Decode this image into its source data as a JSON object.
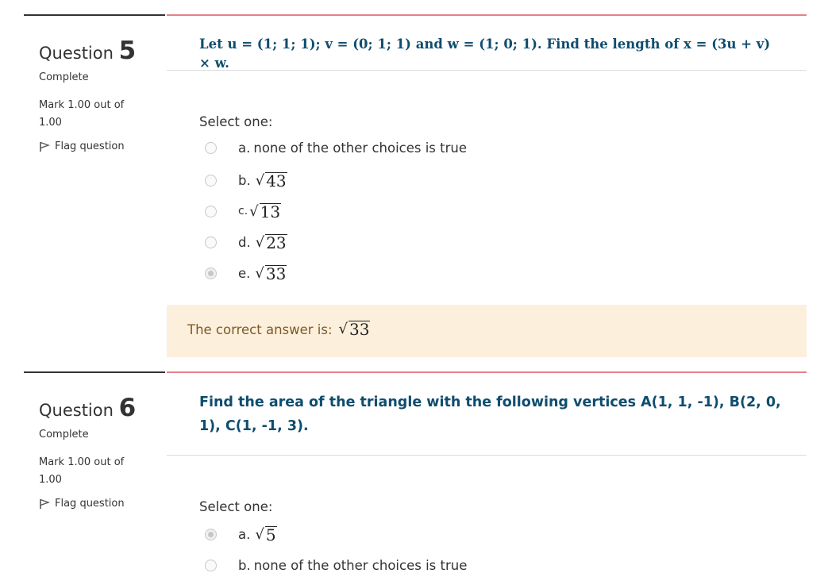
{
  "questions": [
    {
      "label": "Question",
      "number": "5",
      "state": "Complete",
      "grade": "Mark 1.00 out of 1.00",
      "flag_label": "Flag question",
      "text": "Let u = (1; 1; 1); v = (0; 1; 1) and w = (1; 0; 1). Find the length of x = (3u + v) × w.",
      "prompt": "Select one:",
      "options": [
        {
          "letter": "a.",
          "text": "none of the other choices is true",
          "sqrt": "",
          "selected": false
        },
        {
          "letter": "b.",
          "text": "",
          "sqrt": "43",
          "selected": false
        },
        {
          "letter": "c.",
          "text": "",
          "sqrt": "13",
          "selected": false
        },
        {
          "letter": "d.",
          "text": "",
          "sqrt": "23",
          "selected": false
        },
        {
          "letter": "e.",
          "text": "",
          "sqrt": "33",
          "selected": true
        }
      ],
      "feedback_label": "The correct answer is:",
      "feedback_sqrt": "33"
    },
    {
      "label": "Question",
      "number": "6",
      "state": "Complete",
      "grade": "Mark 1.00 out of 1.00",
      "flag_label": "Flag question",
      "text": "Find the area of the triangle with the following vertices A(1, 1, -1), B(2, 0, 1), C(1, -1, 3).",
      "prompt": "Select one:",
      "options": [
        {
          "letter": "a.",
          "text": "",
          "sqrt": "5",
          "selected": true
        },
        {
          "letter": "b.",
          "text": "none of the other choices is true",
          "sqrt": "",
          "selected": false
        }
      ]
    }
  ],
  "symbols": {
    "radical": "√"
  },
  "colors": {
    "question_text": "#0f4d6e",
    "content_border": "#e6808a",
    "feedback_bg": "#fcefdc",
    "feedback_text": "#7d5a29"
  }
}
